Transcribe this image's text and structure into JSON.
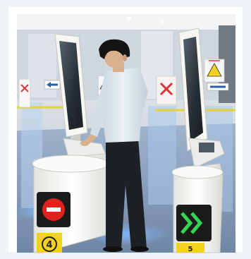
{
  "photo": {
    "subject": "automated-passport-gate",
    "top_caption": "",
    "sign_numbers": [
      "4",
      "5"
    ],
    "gate_signals": {
      "left": "no-entry",
      "right": "proceed"
    }
  },
  "colors": {
    "frame": "#ffffff",
    "ceiling": "#f1f3f5",
    "wall": "#d7dde3",
    "floor": "#8aa1bd",
    "kiosk": "#f4f4f1",
    "screen": "#2c3640",
    "shirt": "#dfe8ef",
    "pants": "#1d2126",
    "hair": "#141414",
    "skin": "#d9b08c",
    "stop_red": "#e0231c",
    "go_green": "#34d454",
    "signal_bg": "#1b1b1b",
    "sign_yellow": "#f2d21e",
    "glass_blue": "#6aa9e8",
    "sign_red": "#d9353b"
  }
}
